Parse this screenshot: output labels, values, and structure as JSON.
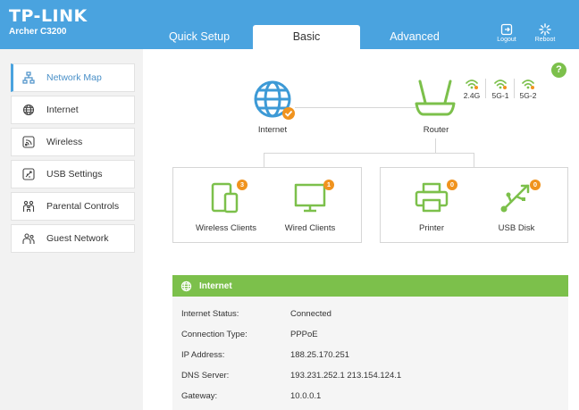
{
  "brand": {
    "logo": "TP-LINK",
    "model": "Archer C3200"
  },
  "tabs": {
    "quick_setup": "Quick Setup",
    "basic": "Basic",
    "advanced": "Advanced"
  },
  "header_buttons": {
    "logout": "Logout",
    "reboot": "Reboot"
  },
  "sidebar": {
    "items": [
      {
        "label": "Network Map",
        "icon": "network-map-icon",
        "active": true
      },
      {
        "label": "Internet",
        "icon": "globe-icon"
      },
      {
        "label": "Wireless",
        "icon": "wireless-icon"
      },
      {
        "label": "USB Settings",
        "icon": "usb-icon"
      },
      {
        "label": "Parental Controls",
        "icon": "family-icon"
      },
      {
        "label": "Guest Network",
        "icon": "guest-icon"
      }
    ]
  },
  "help": "?",
  "map": {
    "internet_label": "Internet",
    "router_label": "Router",
    "bands": [
      "2.4G",
      "5G-1",
      "5G-2"
    ],
    "devices": {
      "wireless_clients": {
        "label": "Wireless Clients",
        "count": "3"
      },
      "wired_clients": {
        "label": "Wired Clients",
        "count": "1"
      },
      "printer": {
        "label": "Printer",
        "count": "0"
      },
      "usb_disk": {
        "label": "USB Disk",
        "count": "0"
      }
    }
  },
  "internet_panel": {
    "title": "Internet",
    "rows": [
      {
        "key": "Internet Status:",
        "value": "Connected"
      },
      {
        "key": "Connection Type:",
        "value": "PPPoE"
      },
      {
        "key": "IP Address:",
        "value": "188.25.170.251"
      },
      {
        "key": "DNS Server:",
        "value": "193.231.252.1 213.154.124.1"
      },
      {
        "key": "Gateway:",
        "value": "10.0.0.1"
      }
    ]
  },
  "colors": {
    "header_blue": "#4aa3df",
    "accent_green": "#7cc04b",
    "badge_orange": "#f0931e",
    "globe_blue": "#3d9ad6"
  }
}
